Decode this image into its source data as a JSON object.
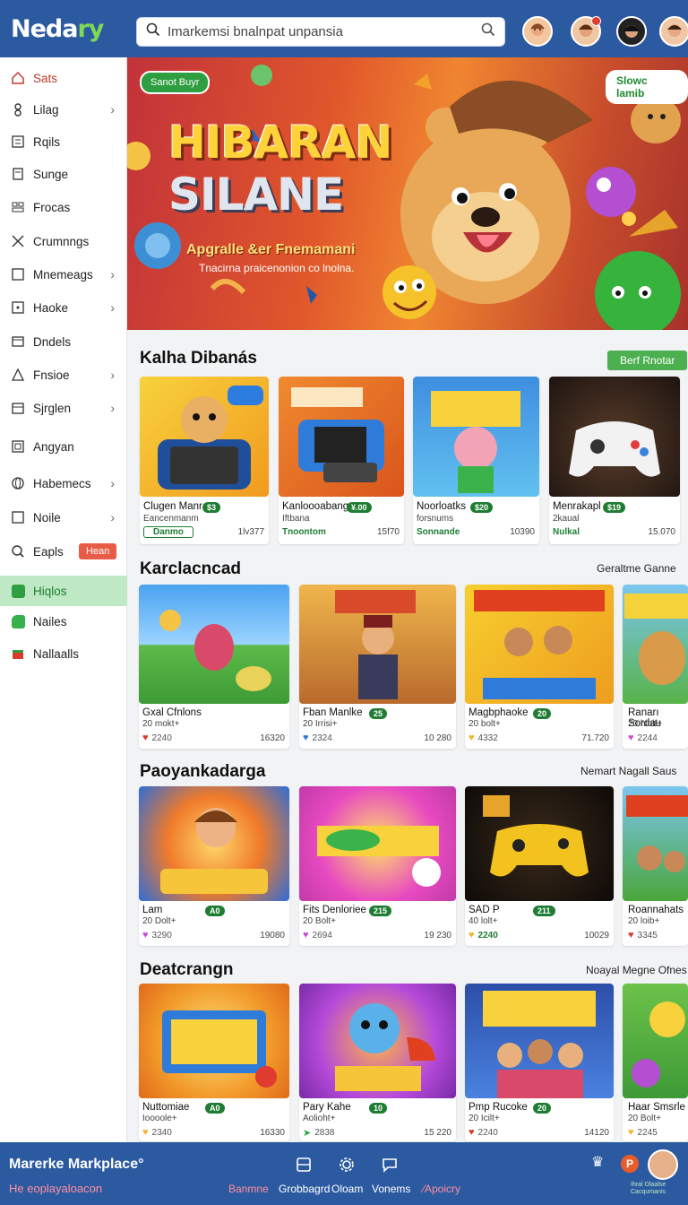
{
  "app": {
    "logo_main": "Neda",
    "logo_accent": "ry"
  },
  "search": {
    "placeholder": "Imarkemsi bnalnpat unpansia"
  },
  "sidebar": {
    "items": [
      {
        "label": "Sats",
        "icon": "house-icon"
      },
      {
        "label": "Lilag",
        "icon": "user-icon"
      },
      {
        "label": "Rqils",
        "icon": "list-icon"
      },
      {
        "label": "Sunge",
        "icon": "document-icon"
      },
      {
        "label": "Frocas",
        "icon": "grid-icon"
      },
      {
        "label": "Crumnngs",
        "icon": "tools-icon"
      },
      {
        "label": "Mnemeags",
        "icon": "square-icon"
      },
      {
        "label": "Haoke",
        "icon": "square-dot-icon"
      },
      {
        "label": "Dndels",
        "icon": "box-icon"
      },
      {
        "label": "Fnsioe",
        "icon": "triangle-icon"
      },
      {
        "label": "Sjrglen",
        "icon": "calendar-icon"
      },
      {
        "label": "Angyan",
        "icon": "frame-icon"
      },
      {
        "label": "Habemecs",
        "icon": "globe-icon"
      },
      {
        "label": "Noile",
        "icon": "square-icon"
      },
      {
        "label": "Eapls",
        "icon": "search-icon",
        "badge": "Hean"
      },
      {
        "label": "Hiqlos",
        "icon": "green-square-icon"
      },
      {
        "label": "Nailes",
        "icon": "green-tag-icon"
      },
      {
        "label": "Nallaalls",
        "icon": "red-gift-icon"
      }
    ]
  },
  "hero": {
    "pill_left": "Sanot Buyr",
    "pill_right": "Slowc lamib",
    "title_line1": "HIBARAN",
    "title_line2": "SILANE",
    "subtitle": "Apgralle &er Fnemamani",
    "tagline": "Tnacirna praicenonion co lnolna."
  },
  "sections": [
    {
      "title": "Kalha Dibanás",
      "action": "Berf Rnotar",
      "cards": [
        {
          "name": "Clugen Manr",
          "tag": "$3",
          "sub": "Eancenmanm",
          "left": "Danmo",
          "right": "1lv377"
        },
        {
          "name": "Kanloooabang",
          "tag": "¥.00",
          "sub": "Iftbana",
          "left": "Tnoontom",
          "right": "15f70"
        },
        {
          "name": "Noorloatks",
          "tag": "$20",
          "sub": "forsnums",
          "left": "Sonnande",
          "right": "10390"
        },
        {
          "name": "Menrakapl",
          "tag": "$19",
          "sub": "2kaual",
          "left": "Nulkal",
          "right": "15.070"
        }
      ]
    },
    {
      "title": "Karclacncad",
      "action": "Geraltme Ganne",
      "cards": [
        {
          "name": "Gxal Cfnlons",
          "tag": "",
          "sub": "20 mokt+",
          "left": "2240",
          "right": "16320"
        },
        {
          "name": "Fban Manlke",
          "tag": "25",
          "sub": "20 Irrisi+",
          "left": "2324",
          "right": "10 280"
        },
        {
          "name": "Magbphaoke",
          "tag": "20",
          "sub": "20 bolt+",
          "left": "4332",
          "right": "71.720"
        },
        {
          "name": "Ranarı Sordau",
          "tag": "",
          "sub": "20 hloif+",
          "left": "2244",
          "right": ""
        }
      ]
    },
    {
      "title": "Paoyankadarga",
      "action": "Nemart Nagall Saus",
      "cards": [
        {
          "name": "Lam",
          "tag": "A0",
          "sub": "20 Dolt+",
          "left": "3290",
          "right": "19080"
        },
        {
          "name": "Fits Denloriee",
          "tag": "215",
          "sub": "20 Bolt+",
          "left": "2694",
          "right": "19 230"
        },
        {
          "name": "SAD P",
          "tag": "211",
          "sub": "40 lolt+",
          "left": "2240",
          "right": "10029"
        },
        {
          "name": "Roannahats",
          "tag": "",
          "sub": "20 loib+",
          "left": "3345",
          "right": ""
        }
      ]
    },
    {
      "title": "Deatcrangn",
      "action": "Noayal Megne Ofnes",
      "cards": [
        {
          "name": "Nuttomiae",
          "tag": "A0",
          "sub": "Ioooole+",
          "left": "2340",
          "right": "16330"
        },
        {
          "name": "Pary Kahe",
          "tag": "10",
          "sub": "Aolioht+",
          "left": "2838",
          "right": "15 220"
        },
        {
          "name": "Pmp Rucoke",
          "tag": "20",
          "sub": "20 Icilt+",
          "left": "2240",
          "right": "14120"
        },
        {
          "name": "Haar Smsrle",
          "tag": "",
          "sub": "20 Bolt+",
          "left": "2245",
          "right": ""
        }
      ]
    }
  ],
  "footer": {
    "title": "Marerke Markplace°",
    "subtitle": "He eoplayaloacon",
    "nav": [
      "Banmne",
      "Grobbagrd",
      "Oloam",
      "Vonems",
      "⁄Apoicry"
    ],
    "corner_text_1": "Ihral Olaalse",
    "corner_text_2": "Cacqumanis"
  },
  "colors": {
    "brand": "#2c5aa0",
    "accent_green": "#4caf50",
    "badge_red": "#e85c47"
  }
}
